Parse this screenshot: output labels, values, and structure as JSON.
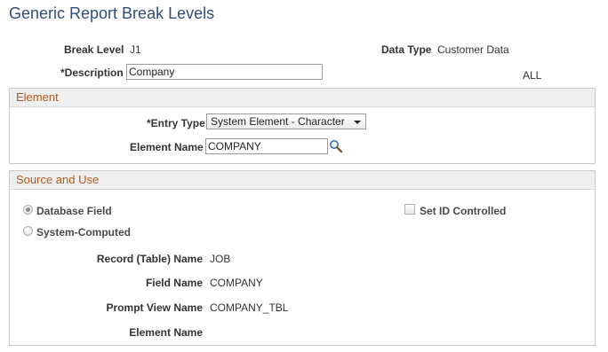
{
  "page_title": "Generic Report Break Levels",
  "header": {
    "break_level_label": "Break Level",
    "break_level_value": "J1",
    "data_type_label": "Data Type",
    "data_type_value": "Customer Data",
    "description_label": "*Description",
    "description_value": "Company",
    "all_text": "ALL"
  },
  "element_group": {
    "title": "Element",
    "entry_type_label": "*Entry Type",
    "entry_type_value": "System Element - Character",
    "element_name_label": "Element Name",
    "element_name_value": "COMPANY",
    "lookup_icon": "magnifier-icon"
  },
  "source_group": {
    "title": "Source and Use",
    "database_field_label": "Database Field",
    "database_field_selected": true,
    "system_computed_label": "System-Computed",
    "system_computed_selected": false,
    "set_id_controlled_label": "Set ID Controlled",
    "set_id_controlled_checked": false,
    "record_label": "Record (Table) Name",
    "record_value": "JOB",
    "field_name_label": "Field Name",
    "field_name_value": "COMPANY",
    "prompt_view_label": "Prompt View Name",
    "prompt_view_value": "COMPANY_TBL",
    "element_name_label": "Element Name",
    "element_name_value": ""
  }
}
